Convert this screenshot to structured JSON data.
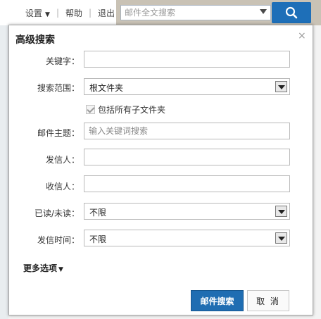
{
  "topbar": {
    "links": [
      "设置",
      "帮助",
      "退出"
    ],
    "search_placeholder": "邮件全文搜索"
  },
  "dialog": {
    "title": "高级搜索",
    "close": "×",
    "keyword_label": "关键字：",
    "keyword_value": "",
    "scope_label": "搜索范围：",
    "scope_value": "根文件夹",
    "include_subfolders_label": "包括所有子文件夹",
    "include_subfolders_checked": true,
    "subject_label": "邮件主题：",
    "subject_placeholder": "输入关键词搜索",
    "sender_label": "发信人：",
    "sender_value": "",
    "recipient_label": "收信人：",
    "recipient_value": "",
    "read_status_label": "已读/未读：",
    "read_status_value": "不限",
    "send_time_label": "发信时间：",
    "send_time_value": "不限",
    "more_options": "更多选项",
    "search_button": "邮件搜索",
    "cancel_button": "取 消"
  },
  "colors": {
    "primary": "#1f6db2",
    "border": "#b9b9b9"
  }
}
